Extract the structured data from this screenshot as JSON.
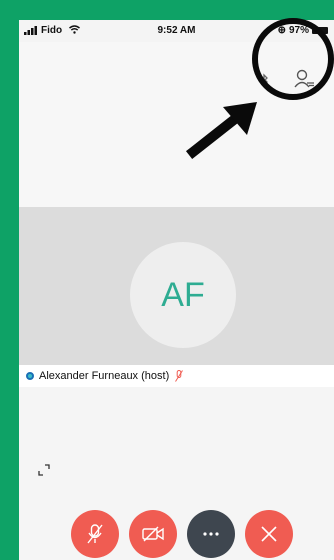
{
  "status_bar": {
    "carrier": "Fido",
    "time": "9:52 AM",
    "battery": "97%"
  },
  "meeting": {
    "avatar_initials": "AF",
    "participant_label": "Alexander Furneaux (host)"
  },
  "controls": [
    {
      "name": "mute-button",
      "icon": "mic-off-icon"
    },
    {
      "name": "stop-video-button",
      "icon": "video-off-icon"
    },
    {
      "name": "more-button",
      "icon": "ellipsis-icon"
    },
    {
      "name": "leave-button",
      "icon": "close-icon"
    }
  ],
  "colors": {
    "background": "#0ea266",
    "avatar_text": "#2eac92",
    "control_red": "#f05c52",
    "control_dark": "#3e464f"
  }
}
